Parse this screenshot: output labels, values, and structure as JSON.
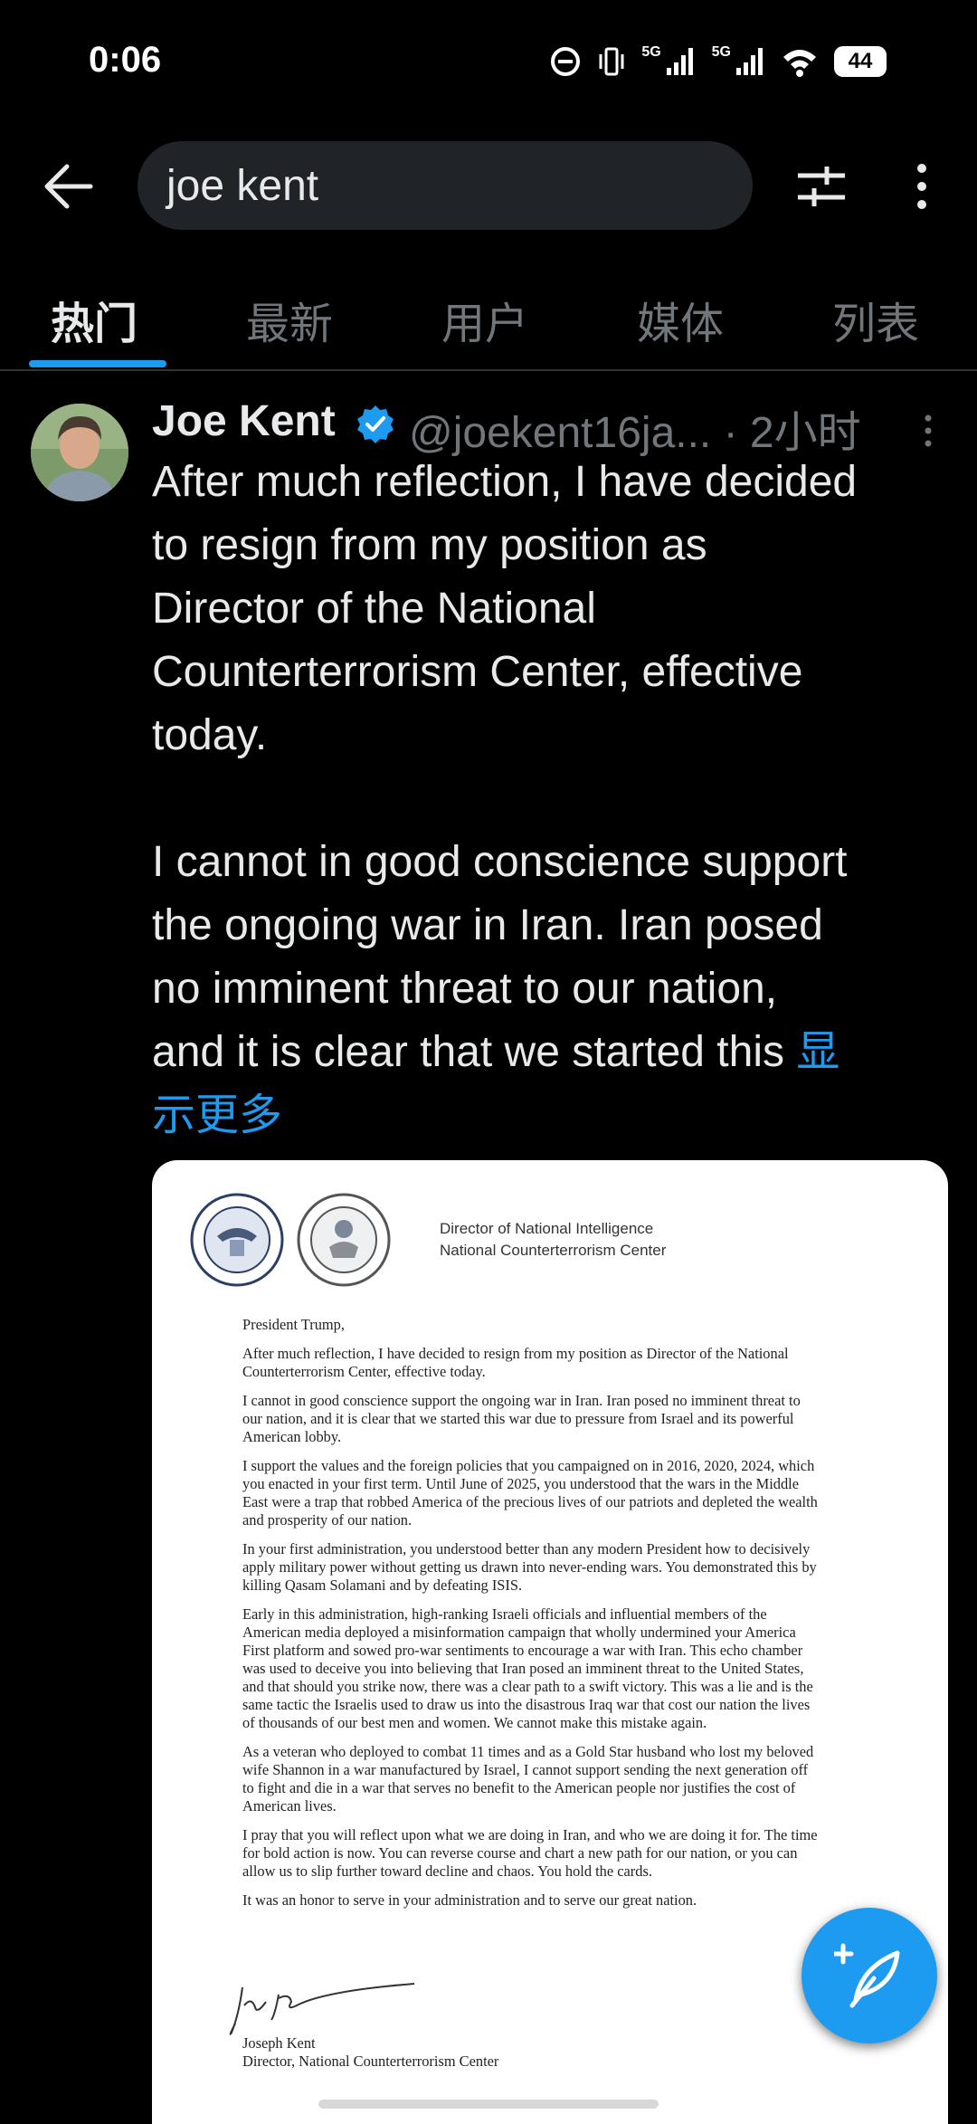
{
  "status_bar": {
    "time": "0:06",
    "signal1_label": "5G",
    "signal2_label": "5G",
    "battery": "44"
  },
  "search": {
    "query": "joe kent"
  },
  "tabs": [
    {
      "label": "热门",
      "active": true
    },
    {
      "label": "最新",
      "active": false
    },
    {
      "label": "用户",
      "active": false
    },
    {
      "label": "媒体",
      "active": false
    },
    {
      "label": "列表",
      "active": false
    }
  ],
  "tweet": {
    "author_name": "Joe Kent",
    "handle_time": "@joekent16ja... · 2小时",
    "paragraph1": "After much reflection, I have decided\nto resign from my position as\nDirector of the National\nCounterterrorism Center, effective\ntoday.",
    "paragraph2": "I cannot in good conscience support\nthe ongoing war in Iran. Iran posed\nno imminent threat to our nation,\nand it is clear that we started this ",
    "show_more": "显\n示更多"
  },
  "letter": {
    "header_line1": "Director of National Intelligence",
    "header_line2": "National Counterterrorism Center",
    "salutation": "President Trump,",
    "p1": "After much reflection, I have decided to resign from my position as Director of the National\nCounterterrorism Center, effective today.",
    "p2": "I cannot in good conscience support the ongoing war in Iran. Iran posed no imminent threat to\nour nation, and it is clear that we started this war due to pressure from Israel and its powerful\nAmerican lobby.",
    "p3": "I support the values and the foreign policies that you campaigned on in 2016, 2020, 2024, which\nyou enacted in your first term. Until June of 2025, you understood that the wars in the Middle\nEast were a trap that robbed America of the precious lives of our patriots and depleted the wealth\nand prosperity of our nation.",
    "p4": "In your first administration, you understood better than any modern President how to decisively\napply military power without getting us drawn into never-ending wars. You demonstrated this by\nkilling Qasam Solamani and by defeating ISIS.",
    "p5": "Early in this administration, high-ranking Israeli officials and influential members of the\nAmerican media deployed a misinformation campaign that wholly undermined your America\nFirst platform and sowed pro-war sentiments to encourage a war with Iran. This echo chamber\nwas used to deceive you into believing that Iran posed an imminent threat to the United States,\nand that should you strike now, there was a clear path to a swift victory. This was a lie and is the\nsame tactic the Israelis used to draw us into the disastrous Iraq war that cost our nation the lives\nof thousands of our best men and women. We cannot make this mistake again.",
    "p6": "As a veteran who deployed to combat 11 times and as a Gold Star husband who lost my beloved\nwife Shannon in a war manufactured by Israel, I cannot support sending the next generation off\nto fight and die in a war that serves no benefit to the American people nor justifies the cost of\nAmerican lives.",
    "p7": "I pray that you will reflect upon what we are doing in Iran, and who we are doing it for. The time\nfor bold action is now. You can reverse course and chart a new path for our nation, or you can\nallow us to slip further toward decline and chaos. You hold the cards.",
    "p8": "It was an honor to serve in your administration and to serve our great nation.",
    "sign_name": "Joseph Kent",
    "sign_title": "Director, National Counterterrorism Center"
  },
  "colors": {
    "accent": "#1d9bf0",
    "background": "#000000",
    "text": "#e7e9ea",
    "muted": "#71767b"
  }
}
